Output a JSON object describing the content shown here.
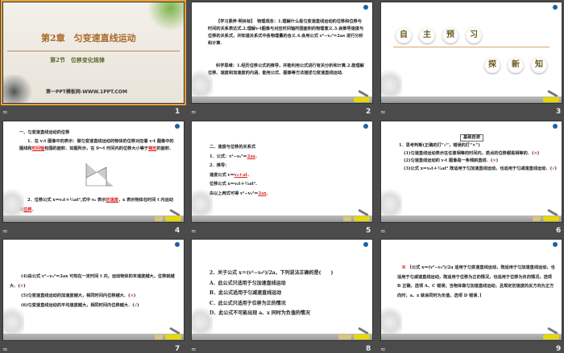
{
  "slides": [
    {
      "number": "1",
      "title": "第2章　匀变速直线运动",
      "subtitle": "第2节　位移变化规律",
      "site": "第一PPT模板网-WWW.1PPT.COM"
    },
    {
      "number": "2",
      "text1": "【学习素养·明目标】　物理观念：1.理解什么是匀变速直线运动的位移和位移与时间的关系表达式.2.理解v-t图像与对应时间轴所围面积的物理意义.3.会推导速度与位移的关系式，并知道关系式中各物理量的含义.4.会用公式 v²−v₀²=2as 进行分析和计算.",
      "text2": "科学思维：1.经历位移公式的推导，并能利用公式进行有关分析和计算.2.能理解位移、速度和加速度的内涵，能用公式、图像等方法描述匀变速直线运动."
    },
    {
      "number": "3",
      "chars1": [
        "自",
        "主",
        "预",
        "习"
      ],
      "chars2": [
        "探",
        "新",
        "知"
      ]
    },
    {
      "number": "4",
      "heading": "一、匀变速直线运动的位移",
      "p1a": "1．在 v-t 图像中的表示：做匀变速直线运动的物体的位移对应着 v-t 图像中的图线和",
      "p1b": "时间轴",
      "p1c": "包围的面积．如图所示，在 0～t 时间内的位移大小等于",
      "p1d": "梯形",
      "p1e": "的面积．",
      "p2a": "2．位移公式 x＝v₀t＋½at²,式中 v₀ 表示",
      "p2b": "初速度",
      "p2c": "，x 表示物体在时间 t 内运动的",
      "p2d": "位移",
      "p2e": "．"
    },
    {
      "number": "5",
      "heading": "二、速度与位移的关系式",
      "l1": "1．公式：v²−v₀²＝",
      "l1a": "2ax",
      "l2": "2．推导：",
      "l3": "速度公式 v＝",
      "l3a": "v₀＋at",
      "l4": "位移公式 x＝v₀t＋½at².",
      "l5": "由以上两式可得 v²−v₀²＝",
      "l5a": "2ax"
    },
    {
      "number": "6",
      "box": "基础自测",
      "q": "1．思考判断(正确的打“√”，错误的打“×”)",
      "items": [
        {
          "t": "(1)匀速直线运动表示在任意相等的时间内，质点的位移都是相等的．",
          "m": "×"
        },
        {
          "t": "(2)匀速直线运动的 v-t 图像是一条倾斜直线．",
          "m": "×"
        },
        {
          "t": "(3)公式 x＝v₀t＋½at² 既适用于匀加速直线运动，也适用于匀减速直线运动．",
          "m": "√"
        }
      ]
    },
    {
      "number": "7",
      "items": [
        {
          "t": "(4)由公式 v²−v₀²＝2ax 可知在一定时间 t 内，运动物体的末速度越大，位移就越大．",
          "m": "×"
        },
        {
          "t": "(5)匀变速直线运动的加速度越大，相同时间内位移越大．",
          "m": "×"
        },
        {
          "t": "(6)匀变速直线运动的平均速度越大，相同时间内位移越大．",
          "m": "√"
        }
      ]
    },
    {
      "number": "8",
      "q": "2．关于公式 x＝(v²−v₀²)/2a，下列说法正确的是(　　)",
      "options": [
        "A．此公式只适用于匀加速直线运动",
        "B．此公式适用于匀减速直线运动",
        "C．此公式只适用于位移为正的情况",
        "D．此公式不可能出现 a、x 同时为负值的情况"
      ]
    },
    {
      "number": "9",
      "answer": "B",
      "text": "[公式 x＝(v²−v₀²)/2a 适用于匀变速直线运动，既适用于匀加速直线运动，也适用于匀减速直线运动，既适用于位移为正的情况，也适用于位移为负的情况，选项 B 正确，选项 A、C 错误；当物体做匀加速直线运动，且规定初速度的反方向为正方向时，a、x 就会同时为负值，选项 D 错误．]"
    }
  ],
  "slide_label": "≈",
  "colors": {
    "accent": "#e8a33c",
    "bg": "#4b4b4b"
  }
}
